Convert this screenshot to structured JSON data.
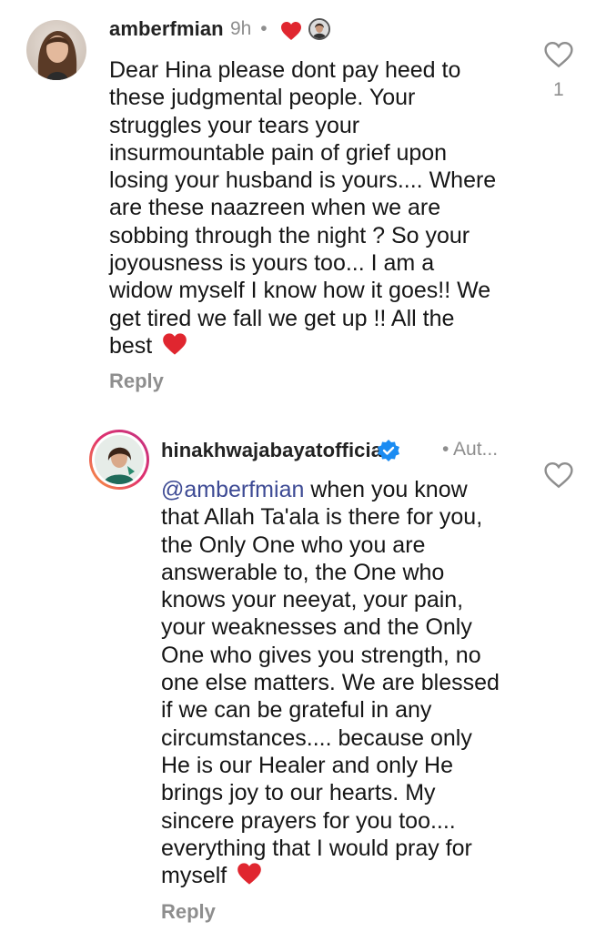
{
  "comment": {
    "username": "amberfmian",
    "time": "9h",
    "separator": "•",
    "body_lines": [
      "Dear Hina please dont pay heed to",
      "these judgmental people. Your",
      "struggles your tears your",
      "insurmountable pain of grief upon",
      "losing your husband is yours.... Where",
      "are these naazreen when we are",
      "sobbing through the night ? So your",
      "joyousness is yours too... I am a",
      "widow myself I know how it goes!! We",
      "get tired we fall we get up !! All the"
    ],
    "last_line": "best",
    "like_count": "1",
    "reply_label": "Reply"
  },
  "reply": {
    "username": "hinakhwajabayatofficial",
    "meta": "• Aut...",
    "mention": "@amberfmian",
    "first_line_rest": " when you know",
    "body_lines": [
      "that Allah Ta'ala is there for you,",
      "the Only One who you are",
      "answerable to, the One who",
      "knows your neeyat, your pain,",
      "your weaknesses and the Only",
      "One who gives you strength, no",
      "one else matters. We are blessed",
      "if we can be grateful in any",
      "circumstances.... because only",
      "He is our Healer and only He",
      "brings joy to our hearts. My",
      "sincere prayers for you too....",
      "everything that I would pray for"
    ],
    "last_line": "myself",
    "reply_label": "Reply"
  },
  "colors": {
    "heart_red": "#e0262f",
    "verified_blue": "#1b8cf2",
    "mention_blue": "#3d4a94",
    "muted_gray": "#8e8e8e"
  },
  "icons": {
    "like": "heart-outline-icon",
    "emoji": "red-heart-emoji",
    "verified": "verified-badge-icon"
  }
}
